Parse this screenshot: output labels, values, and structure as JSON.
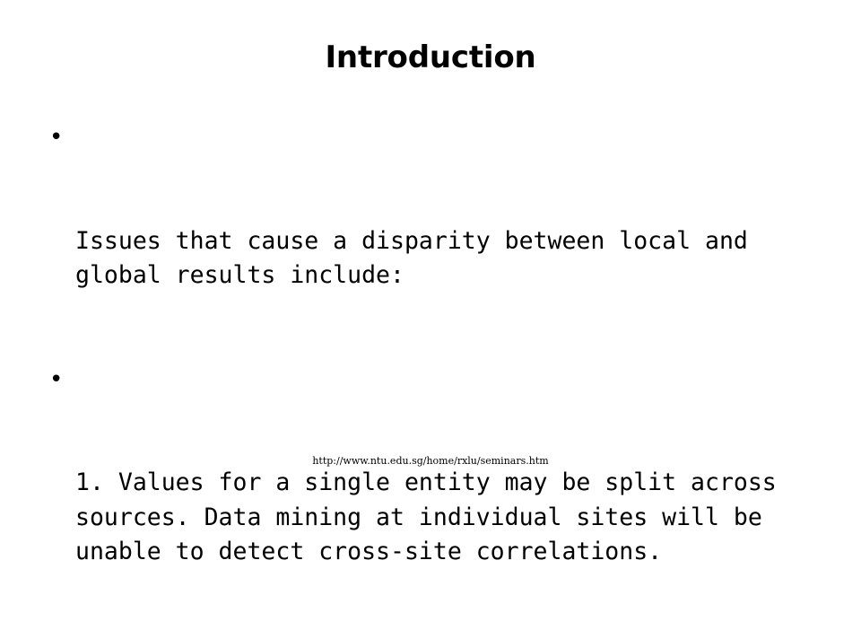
{
  "slide": {
    "title": "Introduction",
    "background_color": "#ffffff",
    "text_color": "#000000",
    "bullets": [
      {
        "marker": "•",
        "text": "Issues that cause a disparity between local and global results include:"
      },
      {
        "marker": "•",
        "text": "1. Values for a single entity may be split across sources. Data mining at individual sites will be unable to detect cross-site correlations."
      }
    ],
    "footer": {
      "url": "http://www.ntu.edu.sg/home/rxlu/seminars.htm"
    }
  }
}
